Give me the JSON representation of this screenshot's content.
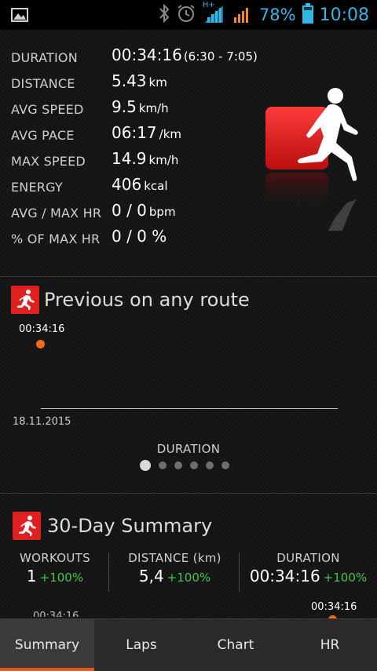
{
  "status_bar": {
    "battery_percent": "78%",
    "time": "10:08",
    "network_type": "H+",
    "icons": [
      "image-icon",
      "bluetooth-icon",
      "alarm-icon",
      "signal-icon",
      "signal-icon",
      "battery-icon"
    ],
    "accent_color": "#33b5e5"
  },
  "stats": [
    {
      "label": "DURATION",
      "value": "00:34:16",
      "unit": "(6:30 - 7:05)"
    },
    {
      "label": "DISTANCE",
      "value": "5.43",
      "unit": "km"
    },
    {
      "label": "AVG SPEED",
      "value": "9.5",
      "unit": "km/h"
    },
    {
      "label": "AVG PACE",
      "value": "06:17",
      "unit": "/km"
    },
    {
      "label": "MAX SPEED",
      "value": "14.9",
      "unit": "km/h"
    },
    {
      "label": "ENERGY",
      "value": "406",
      "unit": "kcal"
    },
    {
      "label": "AVG / MAX HR",
      "value": "0 / 0",
      "unit": "bpm"
    },
    {
      "label": "% OF MAX HR",
      "value": "0 / 0 %",
      "unit": ""
    }
  ],
  "previous": {
    "title": "Previous on any route",
    "point_label": "00:34:16",
    "date": "18.11.2015",
    "metric": "DURATION",
    "pages": 6,
    "active_page": 0
  },
  "summary": {
    "title": "30-Day Summary",
    "workouts": {
      "label": "WORKOUTS",
      "value": "1",
      "change": "+100%"
    },
    "distance": {
      "label": "DISTANCE (km)",
      "value": "5,4",
      "change": "+100%"
    },
    "duration": {
      "label": "DURATION",
      "value": "00:34:16",
      "change": "+100%"
    },
    "peek_left_label": "00:34:16",
    "peek_right_label": "00:34:16"
  },
  "tabs": [
    {
      "label": "Summary",
      "active": true
    },
    {
      "label": "Laps",
      "active": false
    },
    {
      "label": "Chart",
      "active": false
    },
    {
      "label": "HR",
      "active": false
    }
  ],
  "colors": {
    "brand_red": "#e01f1f",
    "accent_orange": "#e8591a",
    "positive_green": "#4cc24c"
  }
}
